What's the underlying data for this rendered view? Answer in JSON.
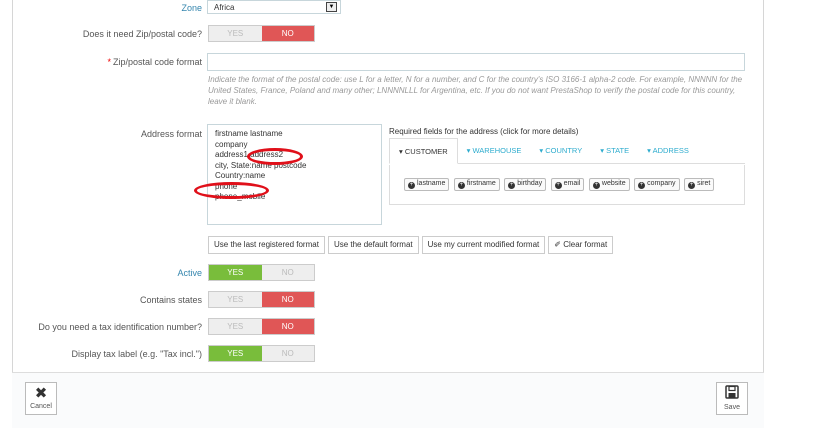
{
  "zone": {
    "label": "Zone",
    "value": "Africa"
  },
  "zip_needed": {
    "label": "Does it need Zip/postal code?",
    "yes": "YES",
    "no": "NO"
  },
  "zip_format": {
    "required_mark": "*",
    "label": "Zip/postal code format",
    "value": "",
    "help": "Indicate the format of the postal code: use L for a letter, N for a number, and C for the country's ISO 3166-1 alpha-2 code. For example, NNNNN for the United States, France, Poland and many other; LNNNNLLL for Argentina, etc. If you do not want PrestaShop to verify the postal code for this country, leave it blank."
  },
  "address_format": {
    "label": "Address format",
    "lines": [
      "firstname lastname",
      "company",
      "address1 address2",
      "city, State:name postcode",
      "Country:name",
      "phone",
      "phone_mobile"
    ]
  },
  "required_fields": {
    "title": "Required fields for the address (click for more details)",
    "tabs": [
      "CUSTOMER",
      "WAREHOUSE",
      "COUNTRY",
      "STATE",
      "ADDRESS"
    ],
    "chips": [
      "lastname",
      "firstname",
      "birthday",
      "email",
      "website",
      "company",
      "siret"
    ]
  },
  "format_buttons": {
    "last_registered": "Use the last registered format",
    "default": "Use the default format",
    "current_modified": "Use my current modified format",
    "clear": "Clear format"
  },
  "active": {
    "label": "Active",
    "yes": "YES",
    "no": "NO"
  },
  "contains_states": {
    "label": "Contains states",
    "yes": "YES",
    "no": "NO"
  },
  "tax_id": {
    "label": "Do you need a tax identification number?",
    "yes": "YES",
    "no": "NO"
  },
  "tax_label": {
    "label": "Display tax label (e.g. \"Tax incl.\")",
    "yes": "YES",
    "no": "NO"
  },
  "footer": {
    "cancel": "Cancel",
    "save": "Save"
  },
  "colors": {
    "yes_active": "#79bd3b",
    "no_active": "#e05656",
    "link": "#2eacce",
    "annotation": "#e0101a"
  }
}
